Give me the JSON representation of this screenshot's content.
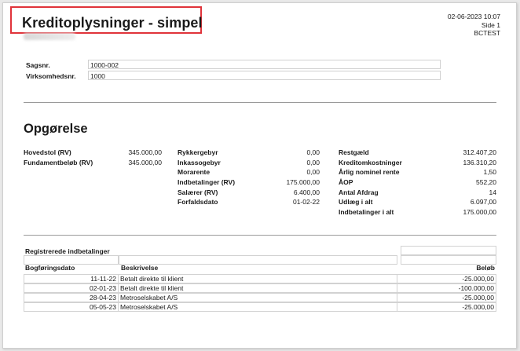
{
  "header": {
    "title": "Kreditoplysninger - simpel",
    "datetime": "02-06-2023 10:07",
    "page": "Side 1",
    "user": "BCTEST"
  },
  "case": [
    {
      "label": "Sagsnr.",
      "value": "1000-002"
    },
    {
      "label": "Virksomhedsnr.",
      "value": "1000"
    }
  ],
  "section_title": "Opgørelse",
  "summary": {
    "col1": [
      {
        "label": "Hovedstol (RV)",
        "value": "345.000,00"
      },
      {
        "label": "Fundamentbeløb (RV)",
        "value": "345.000,00"
      }
    ],
    "col2": [
      {
        "label": "Rykkergebyr",
        "value": "0,00"
      },
      {
        "label": "Inkassogebyr",
        "value": "0,00"
      },
      {
        "label": "Morarente",
        "value": "0,00"
      },
      {
        "label": "Indbetalinger (RV)",
        "value": "175.000,00"
      },
      {
        "label": "Salærer (RV)",
        "value": "6.400,00"
      },
      {
        "label": "Forfaldsdato",
        "value": "01-02-22"
      }
    ],
    "col3": [
      {
        "label": "Restgæld",
        "value": "312.407,20"
      },
      {
        "label": "Kreditomkostninger",
        "value": "136.310,20"
      },
      {
        "label": "Årlig nominel rente",
        "value": "1,50"
      },
      {
        "label": "ÅOP",
        "value": "552,20"
      },
      {
        "label": "Antal Afdrag",
        "value": "14"
      },
      {
        "label": "Udlæg i alt",
        "value": "6.097,00"
      },
      {
        "label": "Indbetalinger i alt",
        "value": "175.000,00"
      }
    ]
  },
  "payments": {
    "title": "Registrerede indbetalinger",
    "columns": {
      "date": "Bogføringsdato",
      "desc": "Beskrivelse",
      "amount": "Beløb"
    },
    "rows": [
      {
        "date": "11-11-22",
        "desc": "Betalt direkte til klient",
        "amount": "-25.000,00"
      },
      {
        "date": "02-01-23",
        "desc": "Betalt direkte til klient",
        "amount": "-100.000,00"
      },
      {
        "date": "28-04-23",
        "desc": "Metroselskabet A/S",
        "amount": "-25.000,00"
      },
      {
        "date": "05-05-23",
        "desc": "Metroselskabet A/S",
        "amount": "-25.000,00"
      }
    ]
  }
}
